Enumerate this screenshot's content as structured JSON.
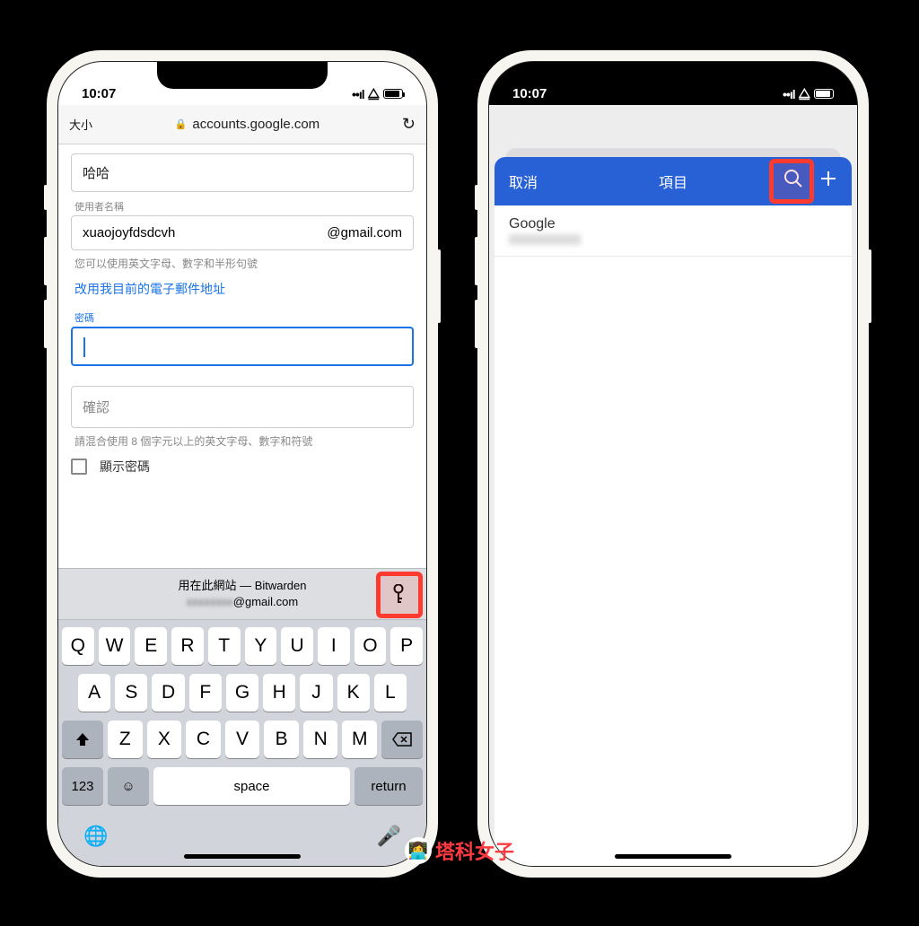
{
  "status": {
    "time": "10:07"
  },
  "left": {
    "browser": {
      "textSize": "大小",
      "url": "accounts.google.com"
    },
    "form": {
      "nameValue": "哈哈",
      "usernameLabel": "使用者名稱",
      "usernameValue": "xuaojoyfdsdcvh",
      "usernameSuffix": "@gmail.com",
      "usernameHelper": "您可以使用英文字母、數字和半形句號",
      "useExistingEmail": "改用我目前的電子郵件地址",
      "passwordLabel": "密碼",
      "confirmPlaceholder": "確認",
      "passwordHelper": "請混合使用 8 個字元以上的英文字母、數字和符號",
      "showPassword": "顯示密碼"
    },
    "autofill": {
      "line1": "用在此網站 — Bitwarden",
      "line2suffix": "@gmail.com"
    },
    "keyboard": {
      "row1": [
        "Q",
        "W",
        "E",
        "R",
        "T",
        "Y",
        "U",
        "I",
        "O",
        "P"
      ],
      "row2": [
        "A",
        "S",
        "D",
        "F",
        "G",
        "H",
        "J",
        "K",
        "L"
      ],
      "row3": [
        "Z",
        "X",
        "C",
        "V",
        "B",
        "N",
        "M"
      ],
      "numKey": "123",
      "space": "space",
      "return": "return"
    }
  },
  "right": {
    "header": {
      "cancel": "取消",
      "title": "項目"
    },
    "list": {
      "item1": "Google"
    }
  },
  "watermark": "塔科女子"
}
